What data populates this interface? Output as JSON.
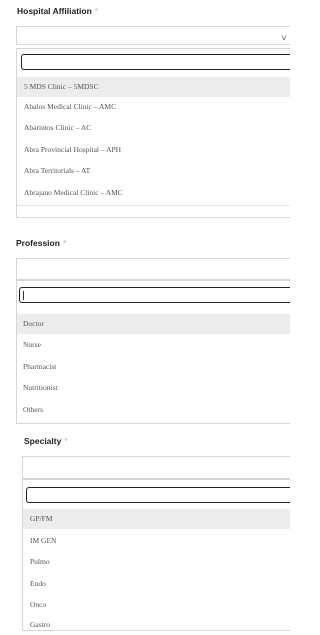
{
  "hospital": {
    "label": "Hospital Affiliation",
    "required_mark": "*",
    "selected_value": "",
    "options": [
      "5 MDS Clinic – 5MDSC",
      "Abalos Medical Clinic – AMC",
      "Abarintos Clinic – AC",
      "Abra Provincial Hospital – APH",
      "Abra Territorials – AT",
      "Abrajano Medical Clinic – AMC"
    ],
    "highlighted_index": 0
  },
  "profession": {
    "label": "Profession",
    "required_mark": "*",
    "selected_value": "",
    "options": [
      "Doctor",
      "Nurse",
      "Pharmacist",
      "Nutritionist",
      "Others"
    ],
    "highlighted_index": 0
  },
  "specialty": {
    "label": "Specialty",
    "required_mark": "*",
    "selected_value": "",
    "options": [
      "GP/FM",
      "IM GEN",
      "Pulmo",
      "Endo",
      "Onco",
      "Gastro"
    ],
    "highlighted_index": 0
  },
  "icons": {
    "dropdown": "chevron-down-icon"
  },
  "colors": {
    "required": "#e8a0a0",
    "highlight": "#ececec",
    "border": "#d6d6d6"
  }
}
